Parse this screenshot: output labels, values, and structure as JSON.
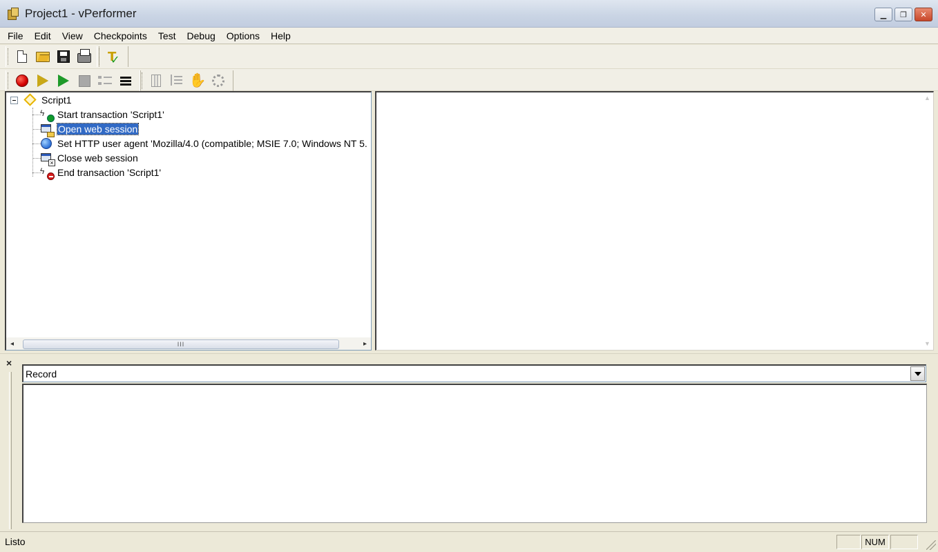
{
  "window": {
    "title": "Project1 - vPerformer",
    "minimize_glyph": "▁",
    "maximize_glyph": "❐",
    "close_glyph": "✕"
  },
  "menu": [
    "File",
    "Edit",
    "View",
    "Checkpoints",
    "Test",
    "Debug",
    "Options",
    "Help"
  ],
  "toolbar1": {
    "icons": [
      "new-file-icon",
      "open-folder-icon",
      "save-icon",
      "print-icon",
      "checkpoint-icon"
    ]
  },
  "toolbar2": {
    "icons": [
      "record-icon",
      "play-icon",
      "run-icon",
      "stop-icon",
      "list-view-icon",
      "lines-icon",
      "columns-icon",
      "step-icon",
      "hand-icon",
      "settings-icon"
    ],
    "hand_glyph": "✋"
  },
  "tree": {
    "root": {
      "label": "Script1",
      "icon": "script-diamond-icon"
    },
    "items": [
      {
        "label": "Start transaction 'Script1'",
        "icon": "start-transaction-icon"
      },
      {
        "label": "Open web session",
        "icon": "open-web-session-icon",
        "selected": true
      },
      {
        "label": "Set HTTP user agent 'Mozilla/4.0 (compatible; MSIE 7.0; Windows NT 5.",
        "icon": "http-globe-icon"
      },
      {
        "label": "Close web session",
        "icon": "close-web-session-icon"
      },
      {
        "label": "End transaction 'Script1'",
        "icon": "end-transaction-icon"
      }
    ],
    "hscroll_left": "◂",
    "hscroll_right": "▸",
    "hscroll_grip": "III"
  },
  "detail": {
    "vscroll_up": "▲",
    "vscroll_down": "▼"
  },
  "output": {
    "close_label": "×",
    "combo_value": "Record"
  },
  "status": {
    "text": "Listo",
    "cells": [
      "",
      "NUM",
      ""
    ]
  },
  "colors": {
    "selection": "#316ac5",
    "record_red": "#d40000",
    "play_yellow": "#c9a818",
    "run_green": "#1e9a2a"
  }
}
